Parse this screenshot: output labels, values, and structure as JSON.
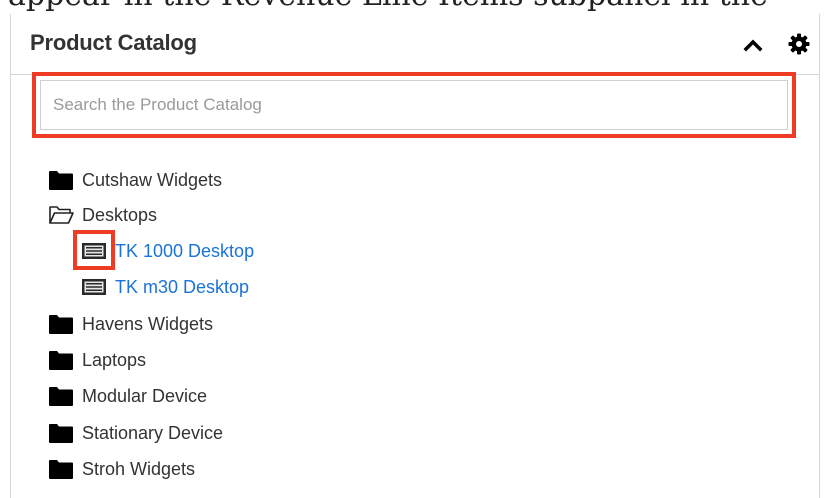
{
  "background_text": "appear in the Revenue Line Items subpanel in the",
  "panel": {
    "title": "Product Catalog",
    "collapse_icon": "chevron-up-icon",
    "settings_icon": "gear-icon"
  },
  "search": {
    "placeholder": "Search the Product Catalog",
    "value": ""
  },
  "tree": {
    "cutshaw_widgets": "Cutshaw Widgets",
    "desktops": "Desktops",
    "tk1000_desktop": "TK 1000 Desktop",
    "tkm30_desktop": "TK m30 Desktop",
    "havens_widgets": "Havens Widgets",
    "laptops": "Laptops",
    "modular_device": "Modular Device",
    "stationary_device": "Stationary Device",
    "stroh_widgets": "Stroh Widgets"
  },
  "colors": {
    "highlight": "#ee3b24",
    "product_link": "#1a73d6",
    "folder": "#000000"
  }
}
